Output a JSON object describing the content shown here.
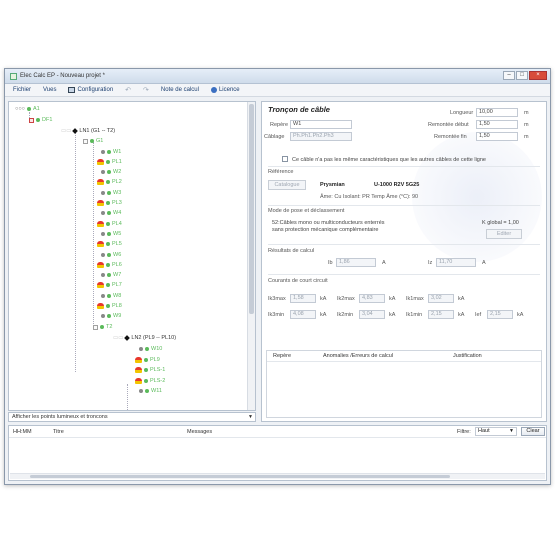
{
  "window": {
    "title": "Elec Calc EP - Nouveau projet *"
  },
  "menu": {
    "fichier": "Fichier",
    "vues": "Vues",
    "configuration": "Configuration",
    "note": "Note de calcul",
    "licence": "Licence"
  },
  "tree": {
    "root": "A1",
    "df": "DF1",
    "ln1": "LN1 (G1 -- T2)",
    "g1": "G1",
    "items1": [
      "W1",
      "PL1",
      "W2",
      "PL2",
      "W3",
      "PL3",
      "W4",
      "PL4",
      "W5",
      "PL5",
      "W6",
      "PL6",
      "W7",
      "PL7",
      "W8",
      "PL8",
      "W9"
    ],
    "t2": "T2",
    "ln2": "LN2 (PL9 -- PL10)",
    "items2": [
      "W10",
      "PL9",
      "PLS-1",
      "PLS-2",
      "W11"
    ]
  },
  "filter": {
    "value": "Afficher les points lumineux et troncons"
  },
  "panel": {
    "title": "Tronçon de câble",
    "repere_label": "Repère",
    "repere_value": "W1",
    "cablage_label": "Câblage",
    "cablage_value": "Ph.Ph1.Ph2.Ph3",
    "longueur_label": "Longueur",
    "longueur_value": "10,00",
    "rem_debut_label": "Remontée début",
    "rem_debut_value": "1,50",
    "rem_fin_label": "Remontée fin",
    "rem_fin_value": "1,50",
    "unit_m": "m",
    "checkbox_label": "Ce câble n'a pas les même caractéristiques que les autres câbles de cette ligne",
    "reference_label": "Référence",
    "catalogue_btn": "Catalogue",
    "brand": "Prysmian",
    "cable_ref": "U-1000 R2V 5G25",
    "cable_spec": "Âme: Cu   Isolant: PR   Temp Âme (°C): 90",
    "pose_label": "Mode de pose et déclassement",
    "pose_desc_1": "52:Câbles mono ou multiconducteurs enterrés",
    "pose_desc_2": "sans protection mécanique complémentaire",
    "k_global": "K global = 1,00",
    "editer_btn": "Editer",
    "resultats_label": "Résultats de calcul",
    "ib_label": "Ib",
    "ib_value": "1,86",
    "iz_label": "Iz",
    "iz_value": "11,70",
    "unit_a": "A",
    "cc_label": "Courants de court circuit",
    "cc": [
      {
        "label": "Ik3max",
        "value": "1,58",
        "unit": "kA"
      },
      {
        "label": "Ik2max",
        "value": "4,83",
        "unit": "kA"
      },
      {
        "label": "Ik1max",
        "value": "3,02",
        "unit": "kA"
      },
      {
        "label": "Ik3min",
        "value": "4,08",
        "unit": "kA"
      },
      {
        "label": "Ik2min",
        "value": "3,04",
        "unit": "kA"
      },
      {
        "label": "Ik1min",
        "value": "2,15",
        "unit": "kA"
      },
      {
        "label": "Ief",
        "value": "2,15",
        "unit": "kA"
      }
    ],
    "table_headers": [
      "Repère",
      "Anomalies /Erreurs de calcul",
      "Justification"
    ]
  },
  "log": {
    "headers": [
      "HH:MM",
      "Titre",
      "Messages"
    ],
    "filtre_label": "Filtre:",
    "filtre_value": "Haut",
    "clear_btn": "Clear"
  }
}
